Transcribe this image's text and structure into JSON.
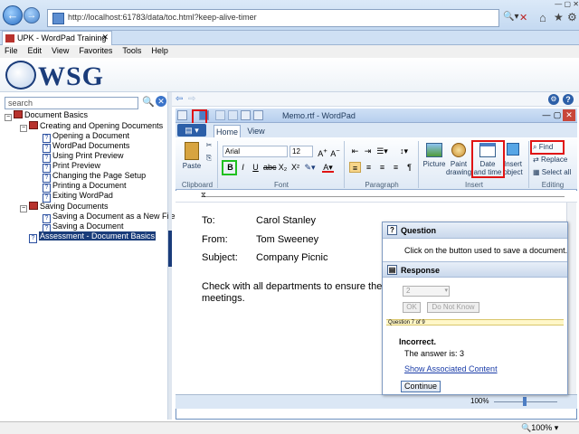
{
  "browser": {
    "url": "http://localhost:61783/data/toc.html?keep-alive-timer",
    "tab_title": "UPK - WordPad Training",
    "menu": [
      "File",
      "Edit",
      "View",
      "Favorites",
      "Tools",
      "Help"
    ],
    "zoom": "100%"
  },
  "header": {
    "logo_text": "WSG"
  },
  "search": {
    "placeholder": "search"
  },
  "toc": [
    {
      "label": "Document Basics",
      "level": 0,
      "type": "book",
      "toggle": "−"
    },
    {
      "label": "Creating and Opening Documents",
      "level": 1,
      "type": "book",
      "toggle": "−"
    },
    {
      "label": "Opening a Document",
      "level": 2,
      "type": "page"
    },
    {
      "label": "WordPad Documents",
      "level": 2,
      "type": "page"
    },
    {
      "label": "Using Print Preview",
      "level": 2,
      "type": "page"
    },
    {
      "label": "Print Preview",
      "level": 2,
      "type": "page"
    },
    {
      "label": "Changing the Page Setup",
      "level": 2,
      "type": "page"
    },
    {
      "label": "Printing a Document",
      "level": 2,
      "type": "page"
    },
    {
      "label": "Exiting WordPad",
      "level": 2,
      "type": "page"
    },
    {
      "label": "Saving Documents",
      "level": 1,
      "type": "book",
      "toggle": "−"
    },
    {
      "label": "Saving a Document as a New File",
      "level": 2,
      "type": "page"
    },
    {
      "label": "Saving a Document",
      "level": 2,
      "type": "page"
    },
    {
      "label": "Assessment - Document Basics",
      "level": 1,
      "type": "page",
      "selected": true
    }
  ],
  "wordpad": {
    "title": "Memo.rtf - WordPad",
    "tabs": [
      "Home",
      "View"
    ],
    "font_name": "Arial",
    "font_size": "12",
    "groups": [
      "Clipboard",
      "Font",
      "Paragraph",
      "Insert",
      "Editing"
    ],
    "buttons": {
      "paste": "Paste",
      "picture": "Picture",
      "paint_drawing": "Paint drawing",
      "date_time": "Date and time",
      "insert_object": "Insert object",
      "find": "Find",
      "replace": "Replace",
      "select_all": "Select all"
    },
    "zoom": "100%",
    "document": {
      "to_label": "To:",
      "to_value": "Carol Stanley",
      "from_label": "From:",
      "from_value": "Tom Sweeney",
      "subject_label": "Subject:",
      "subject_value": "Company Picnic",
      "body_line1": "Check with all departments to ensure the plann",
      "body_line2": "meetings."
    }
  },
  "question_panel": {
    "question_header": "Question",
    "question_text": "Click on the button used to save a document.",
    "response_header": "Response",
    "response_value": "2",
    "ok_label": "OK",
    "do_not_know_label": "Do Not Know",
    "progress_text": "Question 7 of 9",
    "result_title": "Incorrect.",
    "answer_text": "The answer is: 3",
    "show_content_link": "Show Associated Content",
    "continue_label": "Continue"
  }
}
